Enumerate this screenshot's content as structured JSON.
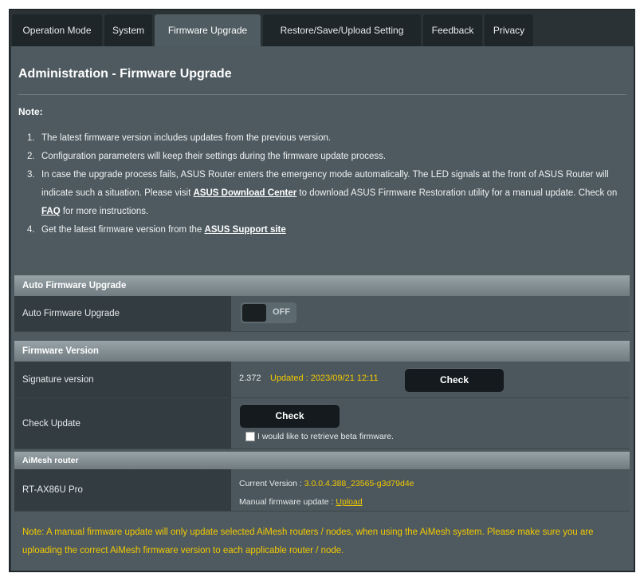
{
  "tabs": [
    {
      "label": "Operation Mode"
    },
    {
      "label": "System"
    },
    {
      "label": "Firmware Upgrade"
    },
    {
      "label": "Restore/Save/Upload Setting"
    },
    {
      "label": "Feedback"
    },
    {
      "label": "Privacy"
    }
  ],
  "page": {
    "title": "Administration - Firmware Upgrade",
    "note_label": "Note:",
    "notes": {
      "n1_num": "1.",
      "n1": "The latest firmware version includes updates from the previous version.",
      "n2_num": "2.",
      "n2": "Configuration parameters will keep their settings during the firmware update process.",
      "n3_num": "3.",
      "n3_a": "In case the upgrade process fails, ASUS Router enters the emergency mode automatically. The LED signals at the front of ASUS Router will indicate such a situation. Please visit ",
      "n3_link1": "ASUS Download Center",
      "n3_b": " to download ASUS Firmware Restoration utility for a manual update. Check on ",
      "n3_link2": "FAQ",
      "n3_c": " for more instructions.",
      "n4_num": "4.",
      "n4_a": "Get the latest firmware version from the ",
      "n4_link": "ASUS Support site"
    }
  },
  "auto_upgrade": {
    "header": "Auto Firmware Upgrade",
    "label": "Auto Firmware Upgrade",
    "toggle_text": "OFF"
  },
  "firmware_version": {
    "header": "Firmware Version",
    "signature_label": "Signature version",
    "signature_value": "2.372",
    "signature_updated": "Updated : 2023/09/21 12:11",
    "signature_check": "Check",
    "check_update_label": "Check Update",
    "check_update_button": "Check",
    "beta_text": "I would like to retrieve beta firmware."
  },
  "aimesh": {
    "header": "AiMesh router",
    "model": "RT-AX86U Pro",
    "current_version_label": "Current Version : ",
    "current_version_value": "3.0.0.4.388_23565-g3d79d4e",
    "manual_update_label": "Manual firmware update : ",
    "upload_link": "Upload"
  },
  "footnote": "Note: A manual firmware update will only update selected AiMesh routers / nodes, when using the AiMesh system. Please make sure you are uploading the correct AiMesh firmware version to each applicable router / node.",
  "colors": {
    "panel": "#4e5a60",
    "accent_yellow": "#f3c900",
    "button": "#141a1d"
  }
}
